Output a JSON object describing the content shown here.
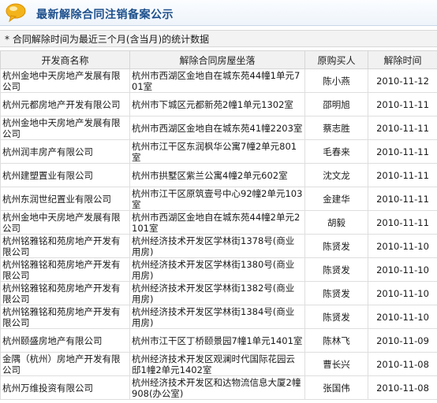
{
  "header": {
    "title": "最新解除合同注销备案公示",
    "icon": "speech-bubble-icon",
    "accent": "#1c4f8c"
  },
  "note": "* 合同解除时间为最近三个月(含当月)的统计数据",
  "table": {
    "columns": [
      "开发商名称",
      "解除合同房屋坐落",
      "原购买人",
      "解除时间"
    ],
    "rows": [
      {
        "developer": "杭州金地中天房地产发展有限公司",
        "address": "杭州市西湖区金地自在城东苑44幢1单元701室",
        "buyer": "陈小燕",
        "date": "2010-11-12"
      },
      {
        "developer": "杭州元都房地产开发有限公司",
        "address": "杭州市下城区元都新苑2幢1单元1302室",
        "buyer": "邵明旭",
        "date": "2010-11-11"
      },
      {
        "developer": "杭州金地中天房地产发展有限公司",
        "address": "杭州市西湖区金地自在城东苑41幢2203室",
        "buyer": "蔡志胜",
        "date": "2010-11-11"
      },
      {
        "developer": "杭州润丰房产有限公司",
        "address": "杭州市江干区东润枫华公寓7幢2单元801室",
        "buyer": "毛春来",
        "date": "2010-11-11"
      },
      {
        "developer": "杭州建塑置业有限公司",
        "address": "杭州市拱墅区紫兰公寓4幢2单元602室",
        "buyer": "沈文龙",
        "date": "2010-11-11"
      },
      {
        "developer": "杭州东润世纪置业有限公司",
        "address": "杭州市江干区原筑壹号中心92幢2单元103室",
        "buyer": "金建华",
        "date": "2010-11-11"
      },
      {
        "developer": "杭州金地中天房地产发展有限公司",
        "address": "杭州市西湖区金地自在城东苑44幢2单元2101室",
        "buyer": "胡毅",
        "date": "2010-11-11"
      },
      {
        "developer": "杭州铭雅铭和苑房地产开发有限公司",
        "address": "杭州经济技术开发区学林街1378号(商业用房)",
        "buyer": "陈贤发",
        "date": "2010-11-10"
      },
      {
        "developer": "杭州铭雅铭和苑房地产开发有限公司",
        "address": "杭州经济技术开发区学林街1380号(商业用房)",
        "buyer": "陈贤发",
        "date": "2010-11-10"
      },
      {
        "developer": "杭州铭雅铭和苑房地产开发有限公司",
        "address": "杭州经济技术开发区学林街1382号(商业用房)",
        "buyer": "陈贤发",
        "date": "2010-11-10"
      },
      {
        "developer": "杭州铭雅铭和苑房地产开发有限公司",
        "address": "杭州经济技术开发区学林街1384号(商业用房)",
        "buyer": "陈贤发",
        "date": "2010-11-10"
      },
      {
        "developer": "杭州颐盛房地产有限公司",
        "address": "杭州市江干区丁桥颐景园7幢1单元1401室",
        "buyer": "陈林飞",
        "date": "2010-11-09"
      },
      {
        "developer": "金隅（杭州）房地产开发有限公司",
        "address": "杭州经济技术开发区观澜时代国际花园云邸1幢2单元1402室",
        "buyer": "曹长兴",
        "date": "2010-11-08"
      },
      {
        "developer": "杭州万维投资有限公司",
        "address": "杭州经济技术开发区和达物流信息大厦2幢908(办公室)",
        "buyer": "张国伟",
        "date": "2010-11-08"
      }
    ]
  }
}
